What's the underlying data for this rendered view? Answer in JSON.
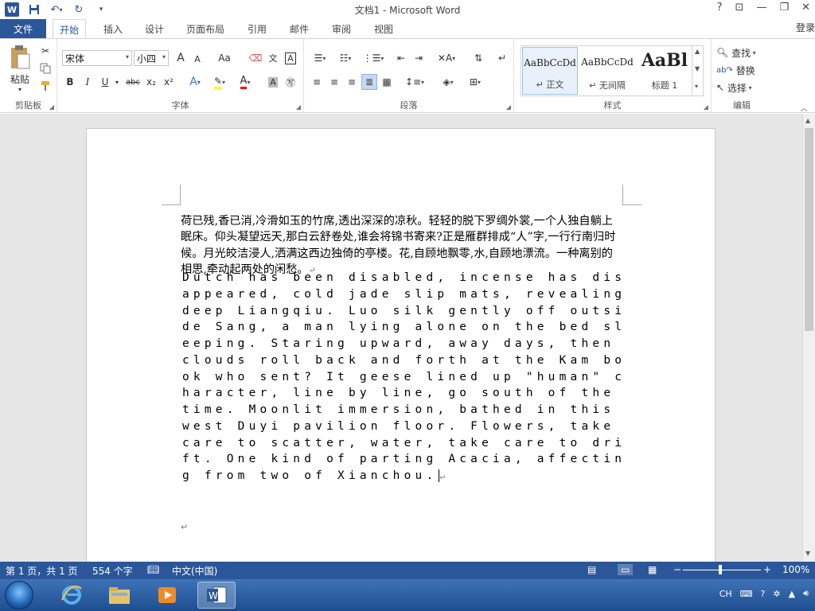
{
  "titlebar": {
    "title": "文档1 - Microsoft Word",
    "help": "?",
    "restore_ribbon": "⊡",
    "minimize": "—",
    "maximize": "❐",
    "close": "✕"
  },
  "tabs": {
    "file": "文件",
    "items": [
      "开始",
      "插入",
      "设计",
      "页面布局",
      "引用",
      "邮件",
      "审阅",
      "视图"
    ],
    "login": "登录"
  },
  "ribbon": {
    "clipboard": {
      "label": "剪贴板",
      "paste": "粘贴"
    },
    "font": {
      "label": "字体",
      "font_name": "宋体",
      "font_size": "小四",
      "bold": "B",
      "italic": "I",
      "underline": "U",
      "strike": "abc",
      "subscript": "x₂",
      "superscript": "x²",
      "grow": "A",
      "shrink": "A",
      "case": "Aa"
    },
    "paragraph": {
      "label": "段落"
    },
    "styles": {
      "label": "样式",
      "items": [
        {
          "preview": "AaBbCcDd",
          "name": "↵ 正文"
        },
        {
          "preview": "AaBbCcDd",
          "name": "↵ 无间隔"
        },
        {
          "preview": "AaBl",
          "name": "标题 1"
        }
      ]
    },
    "editing": {
      "label": "编辑",
      "find": "查找",
      "replace": "替换",
      "select": "选择"
    }
  },
  "document": {
    "chinese_text": "荷已残,香已消,冷滑如玉的竹席,透出深深的凉秋。轻轻的脱下罗绸外裳,一个人独自躺上眠床。仰头凝望远天,那白云舒卷处,谁会将锦书寄来?正是雁群排成“人”字,一行行南归时候。月光皎洁浸人,洒满这西边独倚的亭楼。花,自顾地飘零,水,自顾地漂流。一种离别的相思,牵动起两处的闲愁。",
    "english_text": "Dutch has been disabled, incense has disappeared, cold jade slip mats, revealing deep Liangqiu. Luo silk gently off outside Sang, a man lying alone on the bed sleeping. Staring upward, away days, then clouds roll back and forth at the Kam book who sent? It geese lined up \"human\" character, line by line, go south of the time. Moonlit immersion, bathed in this west Duyi pavilion floor. Flowers, take care to scatter, water, take care to drift. One kind of parting Acacia, affecting from two of Xianchou.",
    "para_mark": "↵"
  },
  "statusbar": {
    "page": "第 1 页，共 1 页",
    "words": "554 个字",
    "language": "中文(中国)",
    "zoom": "100%"
  },
  "taskbar": {
    "tray_lang": "CH"
  }
}
